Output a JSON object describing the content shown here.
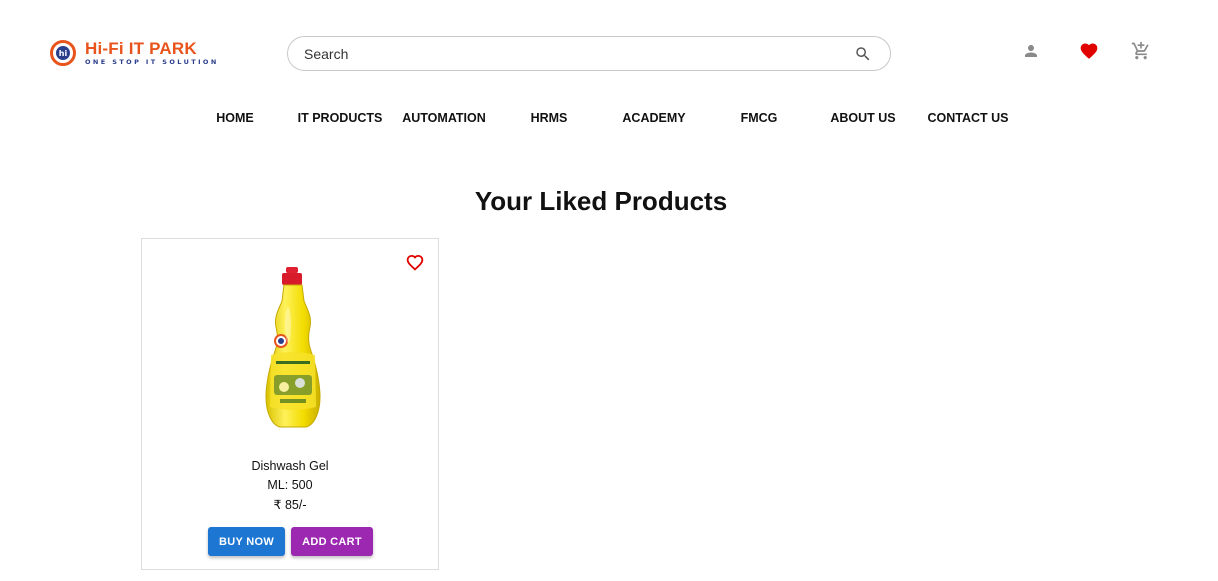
{
  "brand": {
    "badge_text": "hi",
    "name": "Hi-Fi IT PARK",
    "tagline": "ONE STOP IT SOLUTION",
    "primary_color": "#e8541c",
    "secondary_color": "#2a3e8c"
  },
  "search": {
    "placeholder": "Search",
    "value": "",
    "icon": "search-icon"
  },
  "header_icons": [
    {
      "name": "user-icon",
      "color": "#8a8a8a"
    },
    {
      "name": "heart-icon",
      "color": "#e00000"
    },
    {
      "name": "cart-icon",
      "color": "#8a8a8a"
    }
  ],
  "nav": {
    "items": [
      "HOME",
      "IT PRODUCTS",
      "AUTOMATION",
      "HRMS",
      "ACADEMY",
      "FMCG",
      "ABOUT US",
      "CONTACT US"
    ]
  },
  "page": {
    "title": "Your Liked Products"
  },
  "products": [
    {
      "name": "Dishwash Gel",
      "quantity": "ML: 500",
      "price": "₹ 85/-",
      "liked": true,
      "buy_label": "BUY NOW",
      "add_label": "ADD CART"
    }
  ],
  "colors": {
    "buy_button": "#1c76d2",
    "add_button": "#9c27b0",
    "like": "#e00000"
  }
}
